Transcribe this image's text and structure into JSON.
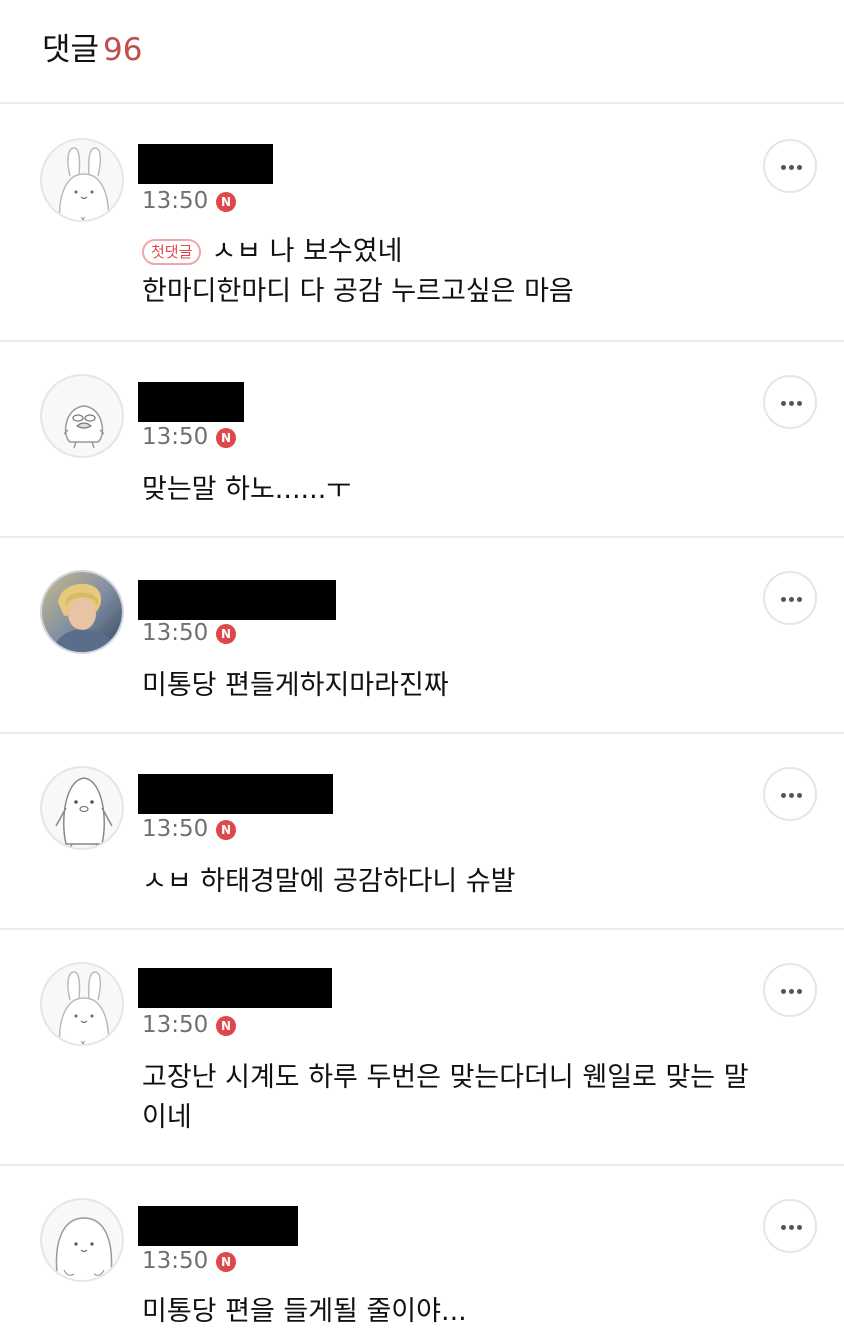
{
  "header": {
    "title": "댓글",
    "count": "96"
  },
  "badge": {
    "n": "N",
    "first": "첫댓글"
  },
  "colors": {
    "accent": "#c0504d",
    "badge": "#e0474c",
    "divider": "#ececec"
  },
  "comments": [
    {
      "avatar": "bunny-avatar",
      "time": "13:50",
      "line1": "ㅅㅂ 나 보수였네",
      "line2": "한마디한마디 다 공감 누르고싶은 마음"
    },
    {
      "avatar": "duck-avatar",
      "time": "13:50",
      "line1": "맞는말 하노......ㅜ"
    },
    {
      "avatar": "photo-avatar",
      "time": "13:50",
      "line1": "미통당 편들게하지마라진짜"
    },
    {
      "avatar": "penguin-avatar",
      "time": "13:50",
      "line1": "ㅅㅂ 하태경말에 공감하다니 슈발"
    },
    {
      "avatar": "bunny-avatar",
      "time": "13:50",
      "line1": "고장난 시계도 하루 두번은 맞는다더니 웬일로 맞는 말",
      "line2": "이네"
    },
    {
      "avatar": "blob-avatar",
      "time": "13:50",
      "line1": "미통당 편을 들게될 줄이야..."
    }
  ]
}
